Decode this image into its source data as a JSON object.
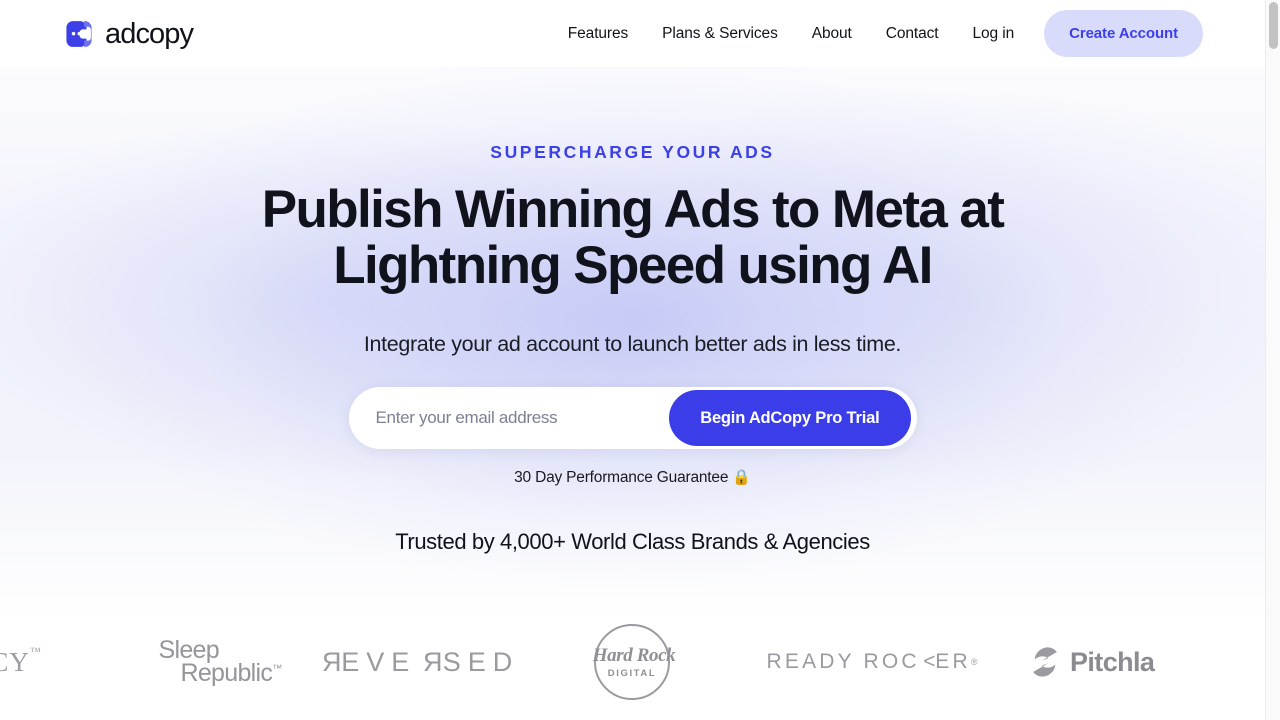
{
  "brand": {
    "name": "adcopy",
    "logo_icon": "adcopy-chat-bubble-icon",
    "accent": "#3d40e8"
  },
  "header": {
    "nav_links": [
      {
        "label": "Features"
      },
      {
        "label": "Plans & Services"
      },
      {
        "label": "About"
      },
      {
        "label": "Contact"
      },
      {
        "label": "Log in"
      }
    ],
    "cta": {
      "label": "Create Account",
      "bg": "#d9dbfb",
      "color": "#3d40e8"
    }
  },
  "hero": {
    "eyebrow": "SUPERCHARGE YOUR ADS",
    "headline_line1": "Publish Winning Ads to Meta at",
    "headline_line2": "Lightning Speed using AI",
    "subhead": "Integrate your ad account to launch better ads in less time.",
    "form": {
      "email_placeholder": "Enter your email address",
      "email_value": "",
      "submit_label": "Begin AdCopy Pro Trial",
      "submit_bg": "#3b3ee8"
    },
    "guarantee_text": "30 Day Performance Guarantee",
    "guarantee_icon": "🔒",
    "trusted_text": "Trusted by 4,000+ World Class Brands & Agencies"
  },
  "logo_strip": {
    "logos": [
      {
        "name": "partial-cy-logo",
        "text": "CY",
        "tm": "™"
      },
      {
        "name": "sleep-republic-logo",
        "line1": "Sleep",
        "line2": "Republic",
        "tm": "™"
      },
      {
        "name": "reversed-logo",
        "text": "REVERSED"
      },
      {
        "name": "hard-rock-digital-logo",
        "top": "Hard Rock",
        "bottom": "DIGITAL"
      },
      {
        "name": "ready-rocker-logo",
        "text": "READY ROCKER",
        "tm": "®"
      },
      {
        "name": "pitchlane-logo",
        "text": "Pitchla"
      }
    ]
  },
  "scrollbar": {
    "position": "right",
    "thumb_top_percent": 0
  }
}
